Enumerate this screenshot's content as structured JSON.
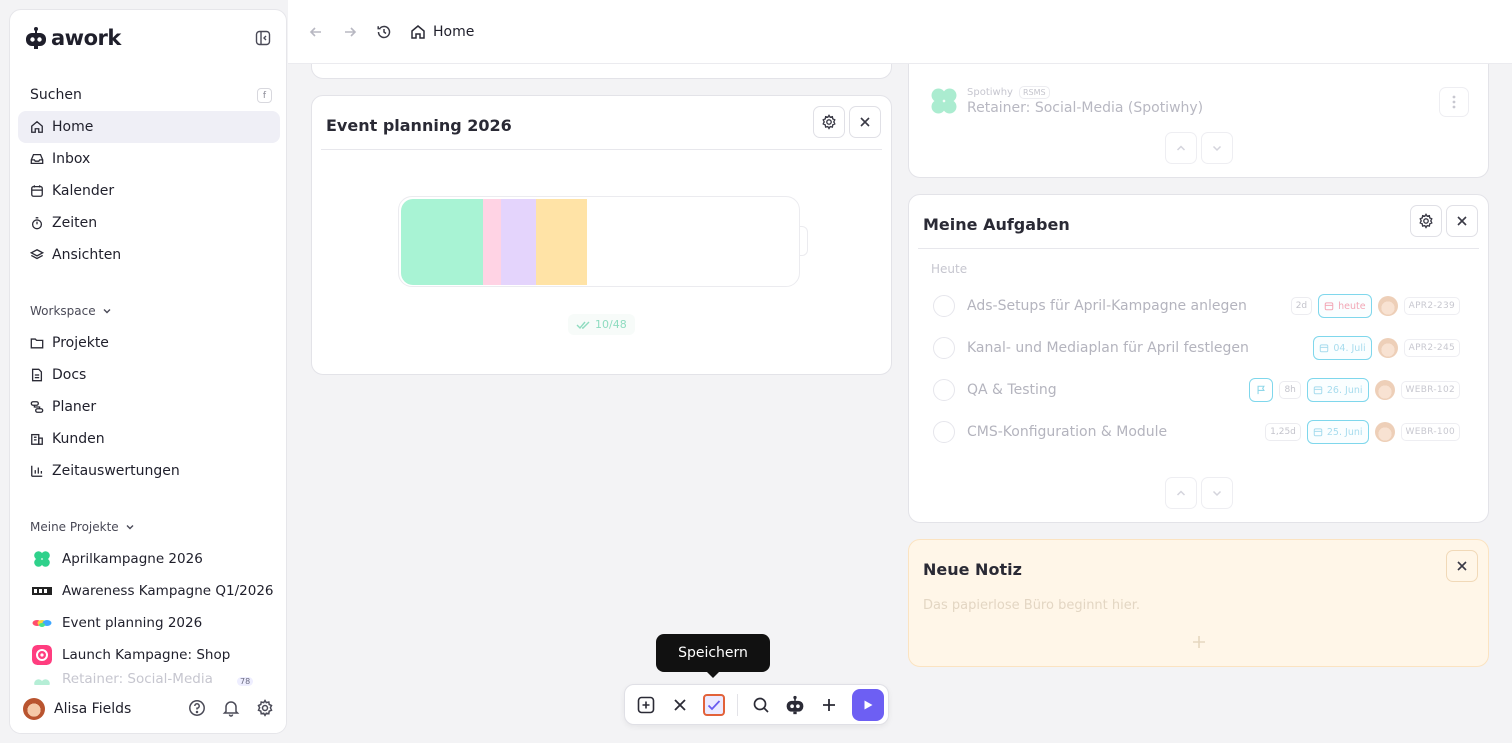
{
  "app": {
    "name": "awork"
  },
  "sidebar": {
    "search": {
      "label": "Suchen",
      "shortcut": "f"
    },
    "main_nav": [
      {
        "label": "Home",
        "icon": "home-icon",
        "active": true
      },
      {
        "label": "Inbox",
        "icon": "inbox-icon"
      },
      {
        "label": "Kalender",
        "icon": "calendar-icon"
      },
      {
        "label": "Zeiten",
        "icon": "stopwatch-icon"
      },
      {
        "label": "Ansichten",
        "icon": "layers-icon"
      }
    ],
    "workspace_label": "Workspace",
    "workspace_nav": [
      {
        "label": "Projekte",
        "icon": "folder-icon"
      },
      {
        "label": "Docs",
        "icon": "document-icon"
      },
      {
        "label": "Planer",
        "icon": "planner-icon"
      },
      {
        "label": "Kunden",
        "icon": "building-icon"
      },
      {
        "label": "Zeitauswertungen",
        "icon": "bar-chart-icon"
      }
    ],
    "my_projects_label": "Meine Projekte",
    "projects": [
      {
        "label": "Aprilkampagne 2026",
        "color": "#2fd18b"
      },
      {
        "label": "Awareness Kampagne Q1/2026",
        "color": "#222222"
      },
      {
        "label": "Event planning 2026",
        "color": "#ff4d6d"
      },
      {
        "label": "Launch Kampagne: Shop",
        "color": "#ff3d7f"
      },
      {
        "label": "Retainer: Social-Media (Spotiwhy)",
        "color": "#2fd18b"
      }
    ],
    "user": {
      "name": "Alisa Fields",
      "notifications": "78"
    }
  },
  "topbar": {
    "breadcrumb": "Home"
  },
  "event_card": {
    "title": "Event planning 2026",
    "progress": "10/48",
    "segments": [
      {
        "color": "#a8f3d4",
        "fraction": 0.205
      },
      {
        "color": "#ffd3e4",
        "fraction": 0.046
      },
      {
        "color": "#e4d4fc",
        "fraction": 0.088
      },
      {
        "color": "#ffe3a6",
        "fraction": 0.129
      }
    ]
  },
  "projects_card": {
    "client": "Spotiwhy",
    "key": "RSMS",
    "project": "Retainer: Social-Media (Spotiwhy)"
  },
  "tasks_card": {
    "title": "Meine Aufgaben",
    "group": "Heute",
    "tasks": [
      {
        "title": "Ads-Setups für April-Kampagne anlegen",
        "effort": "2d",
        "date": "heute",
        "key": "APR2-239",
        "flag": false
      },
      {
        "title": "Kanal- und Mediaplan für April festlegen",
        "effort": "",
        "date": "04. Juli",
        "key": "APR2-245",
        "flag": false
      },
      {
        "title": "QA & Testing",
        "effort": "8h",
        "date": "26. Juni",
        "key": "WEBR-102",
        "flag": true
      },
      {
        "title": "CMS-Konfiguration & Module",
        "effort": "1,25d",
        "date": "25. Juni",
        "key": "WEBR-100",
        "flag": false
      }
    ]
  },
  "note_card": {
    "title": "Neue Notiz",
    "placeholder": "Das papierlose Büro beginnt hier."
  },
  "toolbar": {
    "tooltip": "Speichern"
  }
}
